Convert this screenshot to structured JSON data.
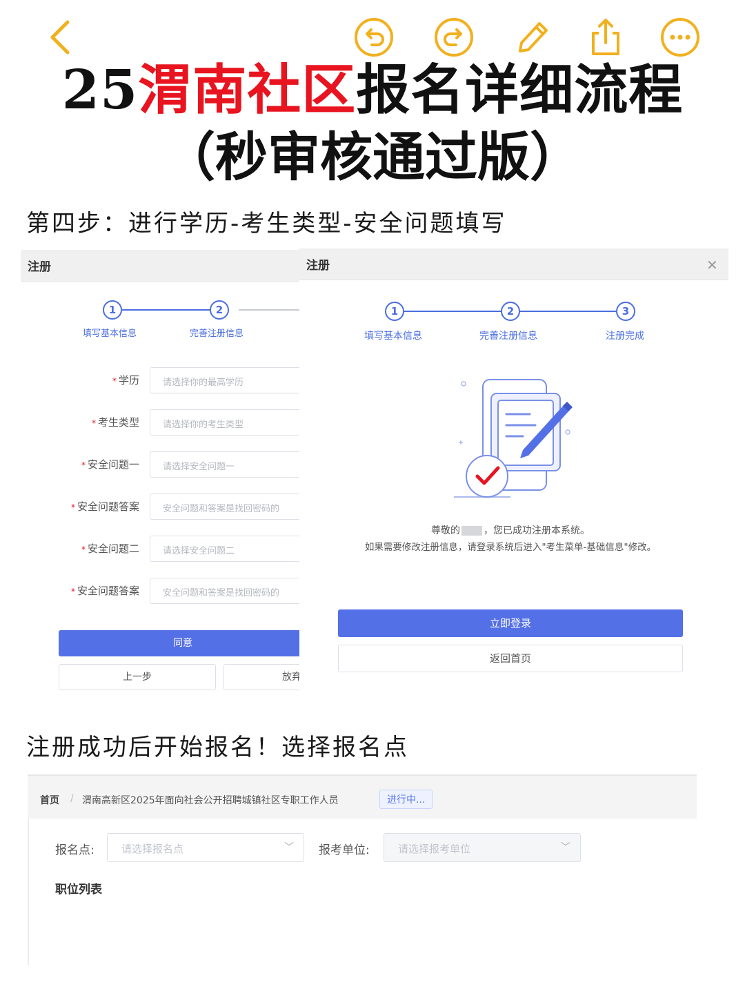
{
  "toolbar": {
    "icons": [
      "back-icon",
      "undo-icon",
      "redo-icon",
      "pencil-icon",
      "share-icon",
      "more-icon"
    ],
    "icon_color": "#f2b01e"
  },
  "title": {
    "prefix": "25",
    "highlight": "渭南社区",
    "suffix": "报名详细流程",
    "line2": "（秒审核通过版）",
    "highlight_color": "#e8141f"
  },
  "step4_caption": "第四步：进行学历-考生类型-安全问题填写",
  "register_left": {
    "header": "注册",
    "steps": [
      {
        "num": "1",
        "label": "填写基本信息"
      },
      {
        "num": "2",
        "label": "完善注册信息"
      }
    ],
    "fields": [
      {
        "label": "学历",
        "placeholder": "请选择你的最高学历"
      },
      {
        "label": "考生类型",
        "placeholder": "请选择你的考生类型"
      },
      {
        "label": "安全问题一",
        "placeholder": "请选择安全问题一"
      },
      {
        "label": "安全问题答案",
        "placeholder": "安全问题和答案是找回密码的"
      },
      {
        "label": "安全问题二",
        "placeholder": "请选择安全问题二"
      },
      {
        "label": "安全问题答案",
        "placeholder": "安全问题和答案是找回密码的"
      }
    ],
    "agree_button": "同意",
    "prev_button": "上一步",
    "abandon_button": "放弃"
  },
  "register_right": {
    "header": "注册",
    "close_icon": "close-icon",
    "steps": [
      {
        "num": "1",
        "label": "填写基本信息"
      },
      {
        "num": "2",
        "label": "完善注册信息"
      },
      {
        "num": "3",
        "label": "注册完成"
      }
    ],
    "success_line1_a": "尊敬的",
    "success_line1_b": "，您已成功注册本系统。",
    "success_line2": "如果需要修改注册信息，请登录系统后进入\"考生菜单-基础信息\"修改。",
    "login_button": "立即登录",
    "home_button": "返回首页",
    "accent_color": "#5470e6"
  },
  "signup_caption": "注册成功后开始报名！选择报名点",
  "signup_page": {
    "breadcrumb_home": "首页",
    "breadcrumb_sep": "/",
    "breadcrumb_item": "渭南高新区2025年面向社会公开招聘城镇社区专职工作人员",
    "status_tag": "进行中...",
    "site_label": "报名点:",
    "site_placeholder": "请选择报名点",
    "unit_label": "报考单位:",
    "unit_placeholder": "请选择报考单位",
    "list_title": "职位列表"
  }
}
